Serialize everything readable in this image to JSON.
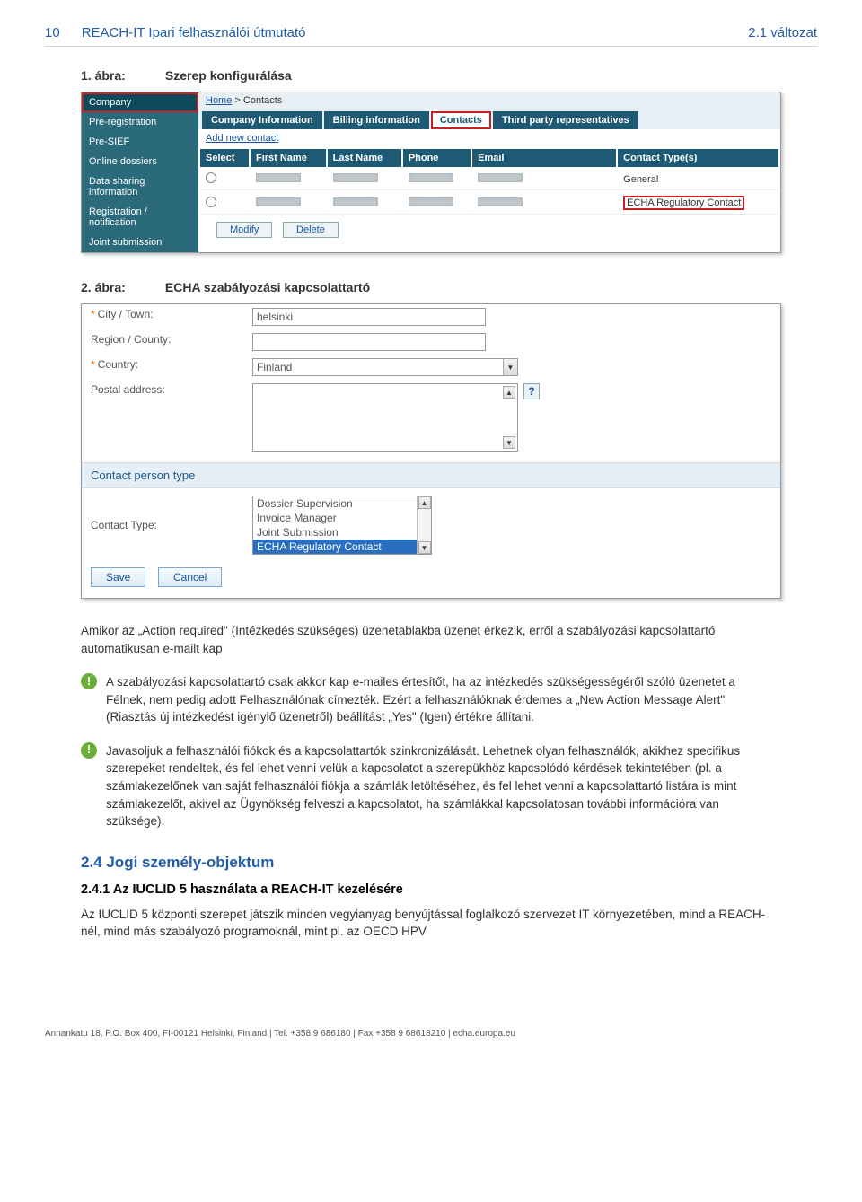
{
  "header": {
    "page_num": "10",
    "title": "REACH-IT Ipari felhasználói útmutató",
    "version": "2.1 változat"
  },
  "fig1": {
    "num": "1. ábra:",
    "caption": "Szerep konfigurálása",
    "sidebar": {
      "items": [
        "Company",
        "Pre-registration",
        "Pre-SIEF",
        "Online dossiers",
        "Data sharing information",
        "Registration / notification",
        "Joint submission"
      ]
    },
    "crumb_home": "Home",
    "crumb_sep": " > ",
    "crumb_current": "Contacts",
    "tabs": [
      "Company Information",
      "Billing information",
      "Contacts",
      "Third party representatives"
    ],
    "add_link": "Add new contact",
    "th": [
      "Select",
      "First Name",
      "Last Name",
      "Phone",
      "Email",
      "Contact Type(s)"
    ],
    "rows": [
      {
        "type": "General"
      },
      {
        "type": "ECHA Regulatory Contact"
      }
    ],
    "btn_modify": "Modify",
    "btn_delete": "Delete"
  },
  "fig2": {
    "num": "2. ábra:",
    "caption": "ECHA szabályozási kapcsolattartó",
    "labels": {
      "city": "City / Town:",
      "region": "Region / County:",
      "country": "Country:",
      "postal": "Postal address:",
      "section": "Contact person type",
      "contact_type": "Contact Type:"
    },
    "values": {
      "city": "helsinki",
      "region": "",
      "country": "Finland"
    },
    "listbox": [
      "Dossier Supervision",
      "Invoice Manager",
      "Joint Submission",
      "ECHA Regulatory Contact"
    ],
    "btn_save": "Save",
    "btn_cancel": "Cancel",
    "help": "?"
  },
  "para1": "Amikor az „Action required\" (Intézkedés szükséges) üzenetablakba üzenet érkezik, erről a szabályozási kapcsolattartó automatikusan e-mailt kap",
  "info1": "A szabályozási kapcsolattartó csak akkor kap e-mailes értesítőt, ha az intézkedés szükségességéről szóló üzenetet a Félnek, nem pedig adott Felhasználónak címezték. Ezért a felhasználóknak érdemes a „New Action Message Alert\" (Riasztás új intézkedést igénylő üzenetről) beállítást „Yes\" (Igen) értékre állítani.",
  "info2": "Javasoljuk a felhasználói fiókok és a kapcsolattartók szinkronizálását. Lehetnek olyan felhasználók, akikhez specifikus szerepeket rendeltek, és fel lehet venni velük a kapcsolatot a szerepükhöz kapcsolódó kérdések tekintetében (pl. a számlakezelőnek van saját felhasználói fiókja a számlák letöltéséhez, és fel lehet venni a kapcsolattartó listára is mint számlakezelőt, akivel az Ügynökség felveszi a kapcsolatot, ha számlákkal kapcsolatosan további információra van szüksége).",
  "h2": "2.4 Jogi személy-objektum",
  "h3": "2.4.1 Az IUCLID 5 használata a REACH-IT kezelésére",
  "para2": "Az IUCLID 5 központi szerepet játszik minden vegyianyag benyújtással foglalkozó szervezet IT környezetében, mind a REACH-nél, mind más szabályozó programoknál, mint pl. az OECD HPV",
  "footer": "Annankatu 18, P.O. Box 400, FI-00121 Helsinki, Finland | Tel. +358 9 686180 | Fax +358 9 68618210 | echa.europa.eu"
}
